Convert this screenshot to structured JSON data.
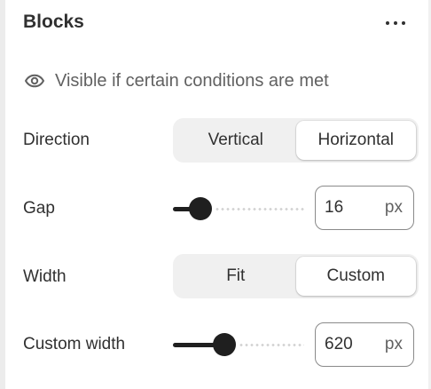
{
  "header": {
    "title": "Blocks",
    "more_icon": "more-horizontal-icon"
  },
  "visibility": {
    "icon": "eye-icon",
    "text": "Visible if certain conditions are met"
  },
  "direction": {
    "label": "Direction",
    "options": [
      "Vertical",
      "Horizontal"
    ],
    "selected": "Horizontal"
  },
  "gap": {
    "label": "Gap",
    "value": "16",
    "unit": "px",
    "slider_fraction": 0.21
  },
  "width": {
    "label": "Width",
    "options": [
      "Fit",
      "Custom"
    ],
    "selected": "Custom"
  },
  "custom_width": {
    "label": "Custom width",
    "value": "620",
    "unit": "px",
    "slider_fraction": 0.39
  },
  "colors": {
    "text": "#303030",
    "muted": "#616161",
    "slider": "#1f1f1f",
    "segment_bg": "#f0f0f0"
  }
}
